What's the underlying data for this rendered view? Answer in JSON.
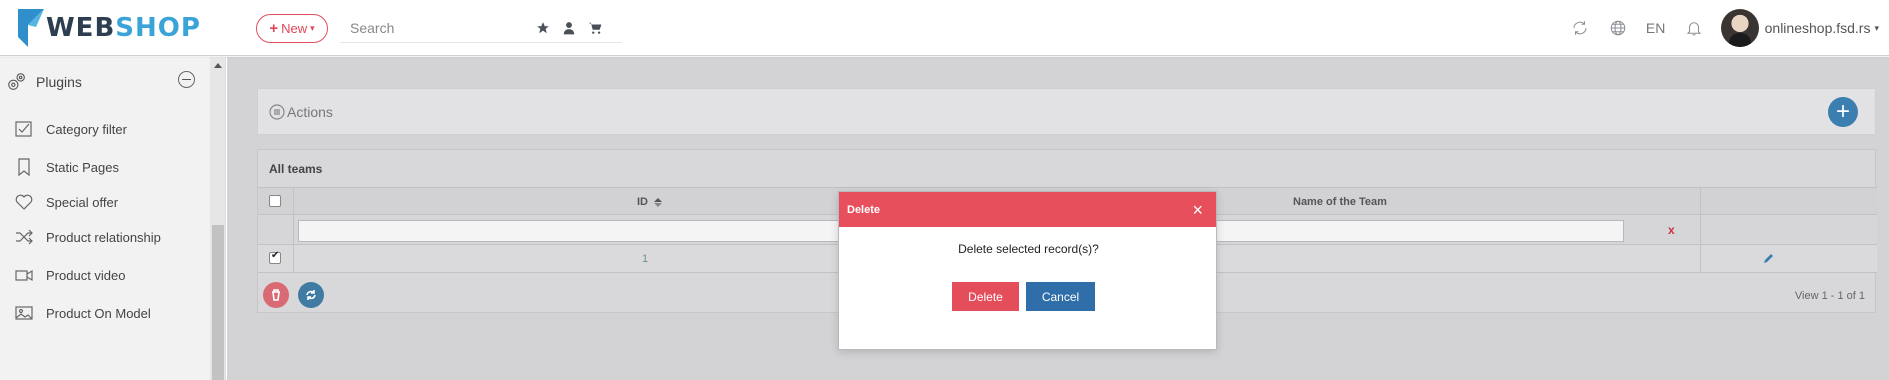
{
  "header": {
    "logo_web": "WEB",
    "logo_shop": "SHOP",
    "new_label": "New",
    "search_placeholder": "Search",
    "language": "EN",
    "user_name": "onlineshop.fsd.rs",
    "brand_color": "#3aa3d8"
  },
  "sidebar": {
    "section_title": "Plugins",
    "items": [
      {
        "label": "Category filter",
        "icon": "checkbox-icon"
      },
      {
        "label": "Static Pages",
        "icon": "bookmark-icon"
      },
      {
        "label": "Special offer",
        "icon": "heart-icon"
      },
      {
        "label": "Product relationship",
        "icon": "shuffle-icon"
      },
      {
        "label": "Product video",
        "icon": "video-icon"
      },
      {
        "label": "Product On Model",
        "icon": "image-icon"
      }
    ]
  },
  "actions": {
    "label": "Actions"
  },
  "grid": {
    "title": "All teams",
    "columns": [
      "ID",
      "Name of the Team"
    ],
    "filter_clear": "x",
    "rows": [
      {
        "id": "1",
        "name": "",
        "checked": true
      }
    ],
    "pager_text": "View 1 - 1 of 1"
  },
  "modal": {
    "title": "Delete",
    "close": "×",
    "message": "Delete selected record(s)?",
    "delete_label": "Delete",
    "cancel_label": "Cancel",
    "danger_color": "#e84f5c",
    "primary_color": "#2f6ea8"
  }
}
